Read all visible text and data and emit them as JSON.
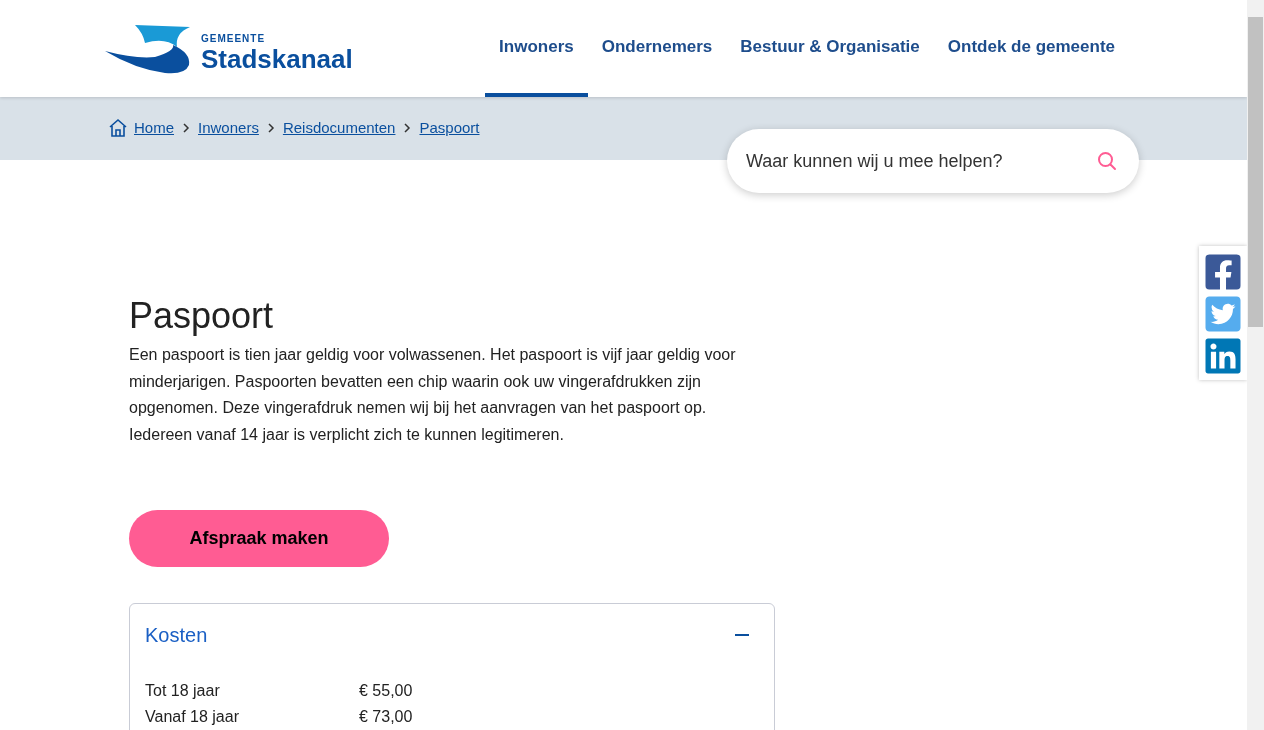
{
  "logo": {
    "small": "GEMEENTE",
    "name": "Stadskanaal"
  },
  "nav": [
    {
      "label": "Inwoners",
      "selected": true
    },
    {
      "label": "Ondernemers",
      "selected": false
    },
    {
      "label": "Bestuur & Organisatie",
      "selected": false
    },
    {
      "label": "Ontdek de gemeente",
      "selected": false
    }
  ],
  "breadcrumb": [
    "Home",
    "Inwoners",
    "Reisdocumenten",
    "Paspoort"
  ],
  "search": {
    "placeholder": "Waar kunnen wij u mee helpen?"
  },
  "title": "Paspoort",
  "intro": "Een paspoort is tien jaar geldig voor volwassenen. Het paspoort is vijf jaar geldig voor minderjarigen. Paspoorten bevatten een chip waarin ook uw vingerafdrukken zijn opgenomen. Deze vingerafdruk nemen wij bij het aanvragen van het paspoort op. Iedereen vanaf 14 jaar is verplicht zich te kunnen legitimeren.",
  "button": "Afspraak maken",
  "accordion": {
    "title": "Kosten",
    "expanded": true,
    "rows": [
      {
        "label": "Tot 18 jaar",
        "price": "€ 55,00"
      },
      {
        "label": "Vanaf 18 jaar",
        "price": "€ 73,00"
      }
    ]
  }
}
